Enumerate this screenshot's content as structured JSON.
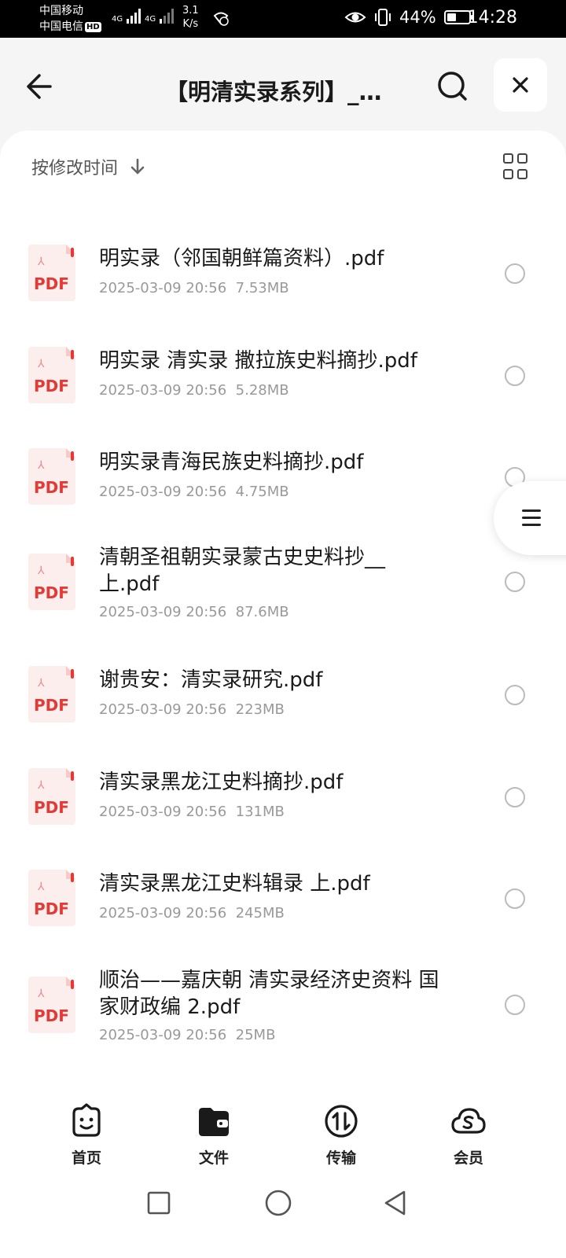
{
  "status_bar": {
    "carrier1": "中国移动",
    "carrier2": "中国电信",
    "hd": "HD",
    "net1": "4G",
    "net2": "4G",
    "speed_value": "3.1",
    "speed_unit": "K/s",
    "battery_pct": "44%",
    "battery_level": 0.44,
    "time": "14:28"
  },
  "header": {
    "title": "【明清实录系列】_…",
    "back_icon": "arrow-left-icon",
    "search_icon": "search-icon",
    "close_icon": "close-icon"
  },
  "toolbar": {
    "sort_label": "按修改时间",
    "sort_icon": "arrow-down-icon",
    "view_icon": "grid-view-icon"
  },
  "files": [
    {
      "name": "明实录（邻国朝鲜篇资料）.pdf",
      "date": "2025-03-09 20:56",
      "size": "7.53MB",
      "type": "PDF"
    },
    {
      "name": "明实录  清实录  撒拉族史料摘抄.pdf",
      "date": "2025-03-09 20:56",
      "size": "5.28MB",
      "type": "PDF"
    },
    {
      "name": "明实录青海民族史料摘抄.pdf",
      "date": "2025-03-09 20:56",
      "size": "4.75MB",
      "type": "PDF"
    },
    {
      "name": "清朝圣祖朝实录蒙古史史料抄__上.pdf",
      "date": "2025-03-09 20:56",
      "size": "87.6MB",
      "type": "PDF"
    },
    {
      "name": "谢贵安：清实录研究.pdf",
      "date": "2025-03-09 20:56",
      "size": "223MB",
      "type": "PDF"
    },
    {
      "name": "清实录黑龙江史料摘抄.pdf",
      "date": "2025-03-09 20:56",
      "size": "131MB",
      "type": "PDF"
    },
    {
      "name": "清实录黑龙江史料辑录 上.pdf",
      "date": "2025-03-09 20:56",
      "size": "245MB",
      "type": "PDF"
    },
    {
      "name": "顺治——嘉庆朝  清实录经济史资料 国家财政编  2.pdf",
      "date": "2025-03-09 20:56",
      "size": "25MB",
      "type": "PDF"
    }
  ],
  "bottom_nav": [
    {
      "label": "首页",
      "icon": "smiley-home-icon"
    },
    {
      "label": "文件",
      "icon": "folder-file-icon"
    },
    {
      "label": "传输",
      "icon": "transfer-icon"
    },
    {
      "label": "会员",
      "icon": "cloud-vip-icon"
    }
  ],
  "system_nav": {
    "recent_icon": "square-recent-icon",
    "home_icon": "circle-home-icon",
    "back_icon": "triangle-back-icon"
  }
}
